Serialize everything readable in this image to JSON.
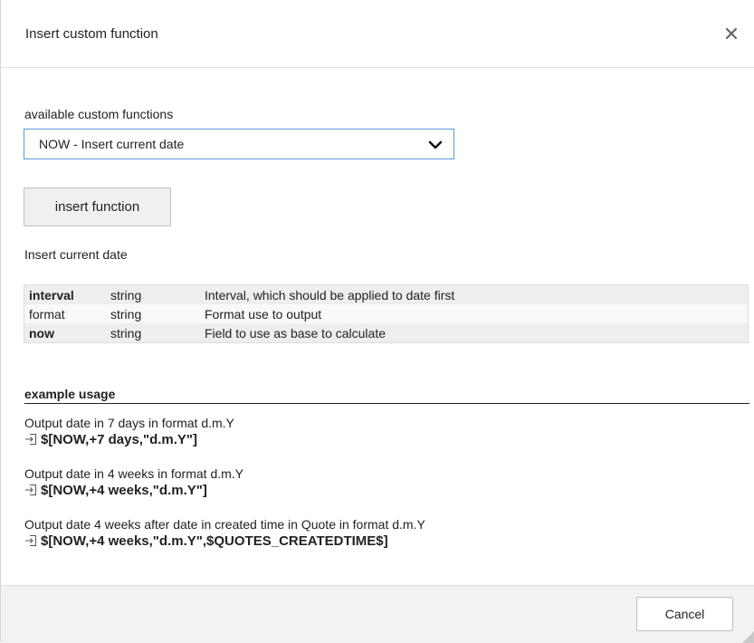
{
  "dialog": {
    "title": "Insert custom function",
    "close_symbol": "✕"
  },
  "form": {
    "select_label": "available custom functions",
    "selected_function": "NOW - Insert current date",
    "insert_button": "insert function",
    "function_description": "Insert current date"
  },
  "parameters": [
    {
      "name": "interval",
      "type": "string",
      "description": "Interval, which should be applied to date first",
      "bold": true
    },
    {
      "name": "format",
      "type": "string",
      "description": "Format use to output",
      "bold": false
    },
    {
      "name": "now",
      "type": "string",
      "description": "Field to use as base to calculate",
      "bold": true
    }
  ],
  "examples": {
    "heading": "example usage",
    "items": [
      {
        "description": "Output date in 7 days in format d.m.Y",
        "code": "$[NOW,+7 days,\"d.m.Y\"]"
      },
      {
        "description": "Output date in 4 weeks in format d.m.Y",
        "code": "$[NOW,+4 weeks,\"d.m.Y\"]"
      },
      {
        "description": "Output date 4 weeks after date in created time in Quote in format d.m.Y",
        "code": "$[NOW,+4 weeks,\"d.m.Y\",$QUOTES_CREATEDTIME$]"
      }
    ]
  },
  "footer": {
    "cancel_button": "Cancel"
  },
  "icons": {
    "close": "close-icon",
    "dropdown": "chevron-down-icon",
    "insert": "insert-icon",
    "resize": "resize-grip-icon"
  }
}
